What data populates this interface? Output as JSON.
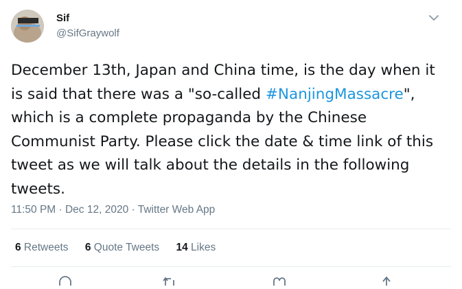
{
  "author": {
    "name": "Sif",
    "handle": "@SifGraywolf"
  },
  "tweet": {
    "text_before": "December 13th, Japan and China time, is the day when it is said that there was a \"so-called ",
    "hashtag": "#NanjingMassacre",
    "text_after": "\", which is a complete propaganda by the Chinese Communist Party. Please click the date & time link of this tweet as we will talk about the details in the following tweets.",
    "time": "11:50 PM",
    "separator1": " · ",
    "date": "Dec 12, 2020",
    "separator2": " · ",
    "source": "Twitter Web App"
  },
  "stats": {
    "retweets_count": "6",
    "retweets_label": " Retweets",
    "quotes_count": "6",
    "quotes_label": " Quote Tweets",
    "likes_count": "14",
    "likes_label": " Likes"
  },
  "colors": {
    "link": "#1b95e0",
    "secondary_text": "#657786",
    "primary_text": "#14171a",
    "divider": "#e6ecf0"
  },
  "icons": {
    "more": "chevron-down-icon",
    "reply": "reply-icon",
    "retweet": "retweet-icon",
    "like": "heart-icon",
    "share": "share-icon"
  }
}
